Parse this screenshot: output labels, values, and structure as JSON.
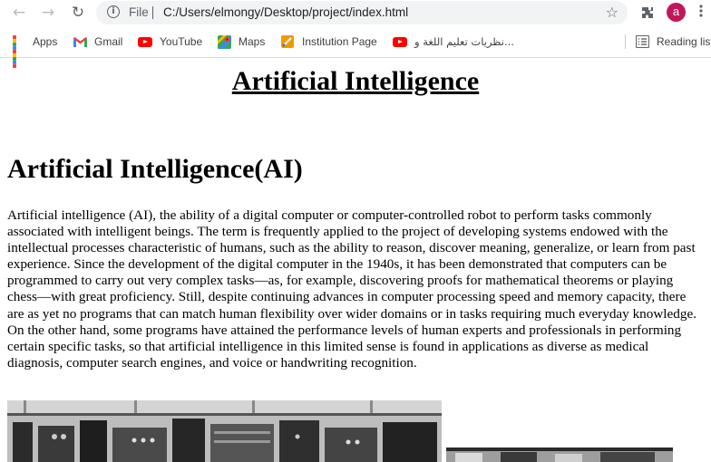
{
  "browser": {
    "nav": {
      "back_icon": "arrow-left-icon",
      "forward_icon": "arrow-right-icon",
      "reload_icon": "reload-icon"
    },
    "address_bar": {
      "scheme_label": "File",
      "url": "C:/Users/elmongy/Desktop/project/index.html"
    },
    "profile_initial": "a",
    "profile_color": "#c2185b"
  },
  "bookmarks": {
    "items": [
      {
        "label": "Apps",
        "icon": "apps-grid-icon"
      },
      {
        "label": "Gmail",
        "icon": "gmail-icon"
      },
      {
        "label": "YouTube",
        "icon": "youtube-icon"
      },
      {
        "label": "Maps",
        "icon": "maps-icon"
      },
      {
        "label": "Institution Page",
        "icon": "institution-page-icon"
      },
      {
        "label": "نظريات تعليم اللغة و...",
        "icon": "youtube-icon"
      }
    ],
    "reading_list": "Reading list"
  },
  "page": {
    "title": "Artificial Intelligence",
    "section_heading": "Artificial Intelligence(AI)",
    "paragraph": "Artificial intelligence (AI), the ability of a digital computer or computer-controlled robot to perform tasks commonly associated with intelligent beings. The term is frequently applied to the project of developing systems endowed with the intellectual processes characteristic of humans, such as the ability to reason, discover meaning, generalize, or learn from past experience. Since the development of the digital computer in the 1940s, it has been demonstrated that computers can be programmed to carry out very complex tasks—as, for example, discovering proofs for mathematical theorems or playing chess—with great proficiency. Still, despite continuing advances in computer processing speed and memory capacity, there are as yet no programs that can match human flexibility over wider domains or in tasks requiring much everyday knowledge. On the other hand, some programs have attained the performance levels of human experts and professionals in performing certain specific tasks, so that artificial intelligence in this limited sense is found in applications as diverse as medical diagnosis, computer search engines, and voice or handwriting recognition."
  }
}
